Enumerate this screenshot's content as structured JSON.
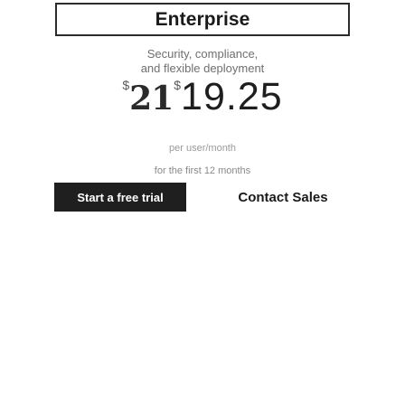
{
  "plan": {
    "title": "Enterprise",
    "description_line1": "Security, compliance,",
    "description_line2": "and flexible deployment"
  },
  "price": {
    "currency_symbol": "$",
    "old_amount": "21",
    "amount": "19.25"
  },
  "billing": {
    "period": "per user/month",
    "trial_note": "for the first 12 months"
  },
  "actions": {
    "primary_label": "Start a free trial",
    "secondary_label": "Contact Sales"
  },
  "colors": {
    "primary_button_bg": "#1f1f1f",
    "primary_button_text": "#ffffff",
    "border": "#2b2b2b",
    "muted_text": "#6f6f6f"
  }
}
